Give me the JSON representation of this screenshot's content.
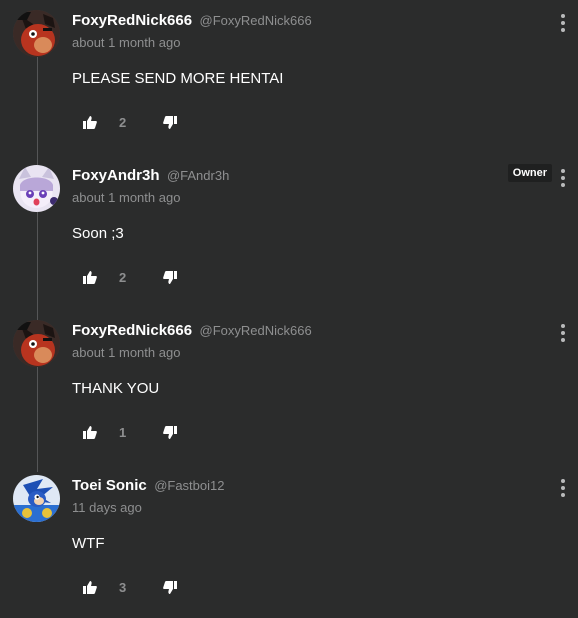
{
  "comments": [
    {
      "name": "FoxyRedNick666",
      "handle": "@FoxyRedNick666",
      "time": "about 1 month ago",
      "text": "PLEASE SEND MORE HENTAI",
      "likes": "2",
      "avatar": "red-fox-animatronic-avatar"
    },
    {
      "name": "FoxyAndr3h",
      "handle": "@FAndr3h",
      "time": "about 1 month ago",
      "text": "Soon ;3",
      "likes": "2",
      "badge": "Owner",
      "avatar": "anime-fox-girl-avatar"
    },
    {
      "name": "FoxyRedNick666",
      "handle": "@FoxyRedNick666",
      "time": "about 1 month ago",
      "text": "THANK YOU",
      "likes": "1",
      "avatar": "red-fox-animatronic-avatar"
    },
    {
      "name": "Toei Sonic",
      "handle": "@Fastboi12",
      "time": "11 days ago",
      "text": "WTF",
      "likes": "3",
      "avatar": "blue-hedgehog-avatar"
    }
  ],
  "icons": {
    "like": "thumbs-up-icon",
    "dislike": "thumbs-down-icon",
    "menu": "more-vertical-icon"
  },
  "colors": {
    "background": "#2b2c2c",
    "text": "#ffffff",
    "muted": "#8e8f90",
    "badge_bg": "#1f2020"
  }
}
